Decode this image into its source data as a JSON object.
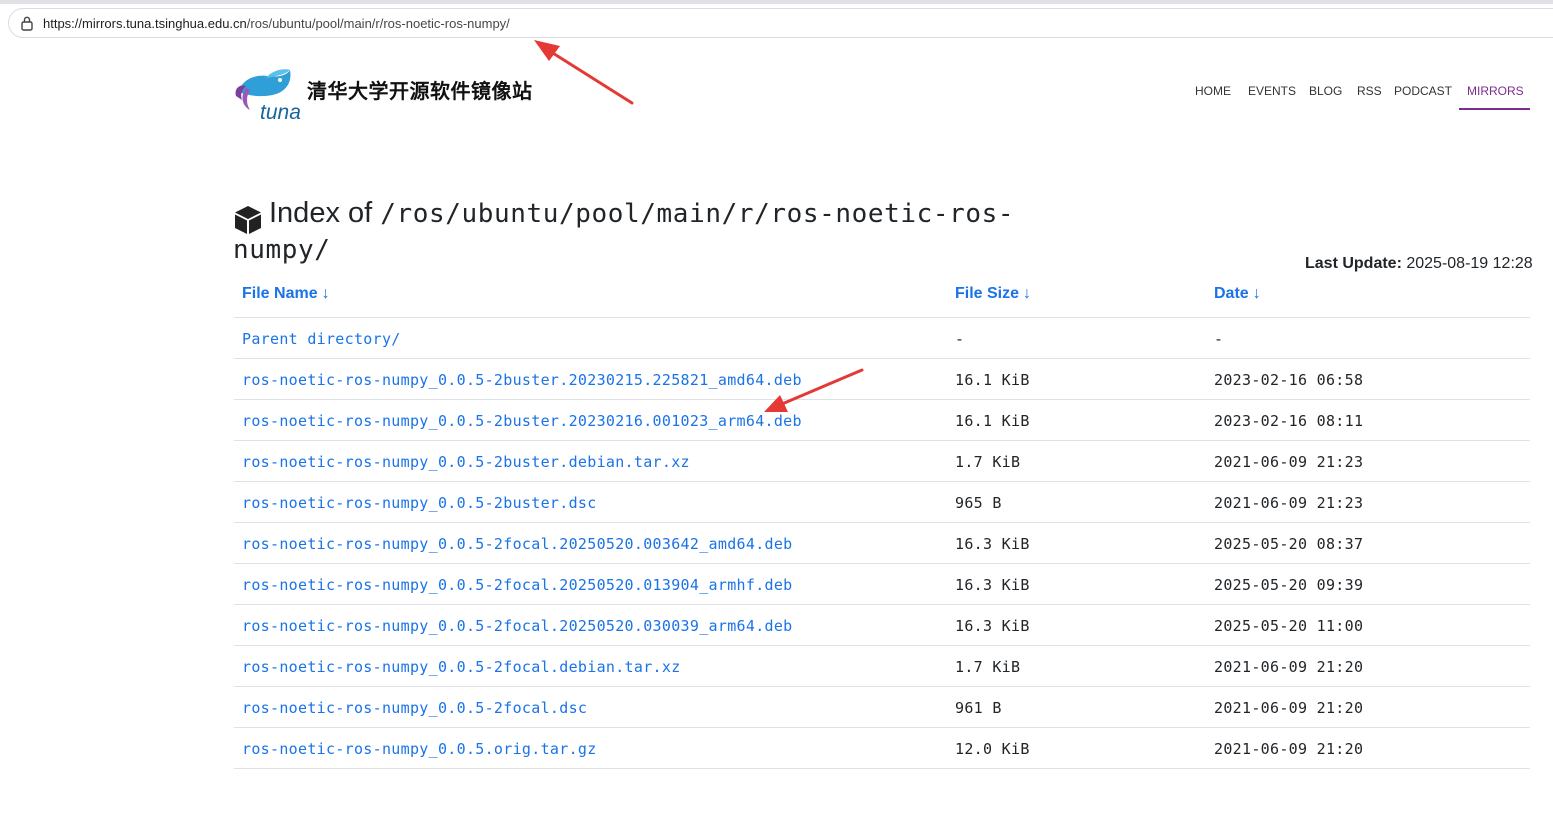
{
  "browser": {
    "url_host": "https://mirrors.tuna.tsinghua.edu.cn",
    "url_path": "/ros/ubuntu/pool/main/r/ros-noetic-ros-numpy/"
  },
  "site": {
    "title": "清华大学开源软件镜像站"
  },
  "nav": [
    {
      "label": "HOME"
    },
    {
      "label": "EVENTS"
    },
    {
      "label": "BLOG"
    },
    {
      "label": "RSS"
    },
    {
      "label": "PODCAST"
    },
    {
      "label": "MIRRORS",
      "active": true
    }
  ],
  "page": {
    "heading_label": "Index of",
    "heading_path": "/ros/ubuntu/pool/main/r/ros-noetic-ros-numpy/",
    "last_update_label": "Last Update:",
    "last_update_value": "2025-08-19 12:28"
  },
  "table": {
    "headers": {
      "name": "File Name",
      "size": "File Size",
      "date": "Date",
      "sort_arrow": "↓"
    },
    "rows": [
      {
        "name": "Parent directory/",
        "size": "-",
        "date": "-"
      },
      {
        "name": "ros-noetic-ros-numpy_0.0.5-2buster.20230215.225821_amd64.deb",
        "size": "16.1 KiB",
        "date": "2023-02-16 06:58"
      },
      {
        "name": "ros-noetic-ros-numpy_0.0.5-2buster.20230216.001023_arm64.deb",
        "size": "16.1 KiB",
        "date": "2023-02-16 08:11"
      },
      {
        "name": "ros-noetic-ros-numpy_0.0.5-2buster.debian.tar.xz",
        "size": "1.7 KiB",
        "date": "2021-06-09 21:23"
      },
      {
        "name": "ros-noetic-ros-numpy_0.0.5-2buster.dsc",
        "size": "965 B",
        "date": "2021-06-09 21:23"
      },
      {
        "name": "ros-noetic-ros-numpy_0.0.5-2focal.20250520.003642_amd64.deb",
        "size": "16.3 KiB",
        "date": "2025-05-20 08:37"
      },
      {
        "name": "ros-noetic-ros-numpy_0.0.5-2focal.20250520.013904_armhf.deb",
        "size": "16.3 KiB",
        "date": "2025-05-20 09:39"
      },
      {
        "name": "ros-noetic-ros-numpy_0.0.5-2focal.20250520.030039_arm64.deb",
        "size": "16.3 KiB",
        "date": "2025-05-20 11:00"
      },
      {
        "name": "ros-noetic-ros-numpy_0.0.5-2focal.debian.tar.xz",
        "size": "1.7 KiB",
        "date": "2021-06-09 21:20"
      },
      {
        "name": "ros-noetic-ros-numpy_0.0.5-2focal.dsc",
        "size": "961 B",
        "date": "2021-06-09 21:20"
      },
      {
        "name": "ros-noetic-ros-numpy_0.0.5.orig.tar.gz",
        "size": "12.0 KiB",
        "date": "2021-06-09 21:20"
      }
    ]
  },
  "colors": {
    "link": "#1a73e8",
    "nav_active": "#7b2d8e",
    "annotation_arrow": "#e53935"
  }
}
